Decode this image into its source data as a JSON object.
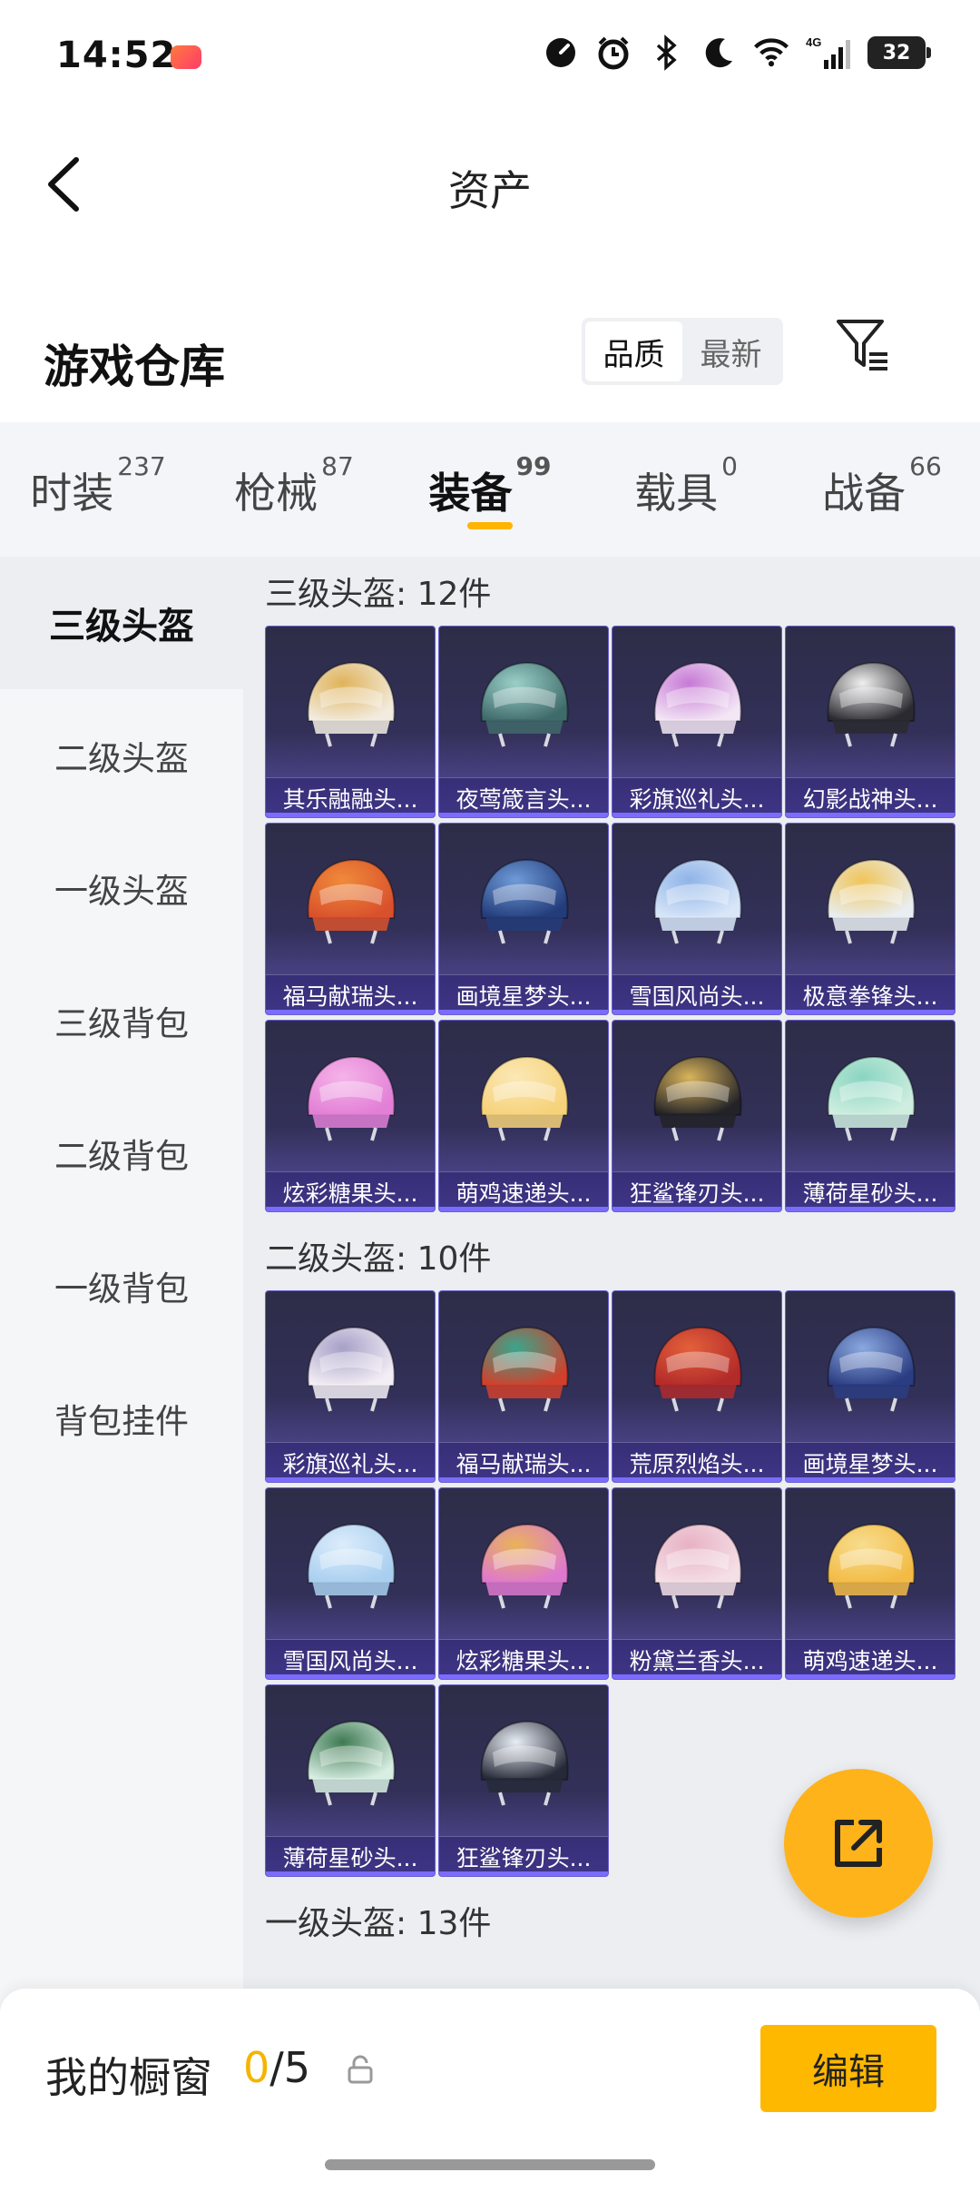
{
  "status_bar": {
    "time": "14:52",
    "battery": "32",
    "network": "4G"
  },
  "header": {
    "title": "资产"
  },
  "warehouse": {
    "title": "游戏仓库",
    "sort_options": [
      "品质",
      "最新"
    ],
    "sort_active": 0
  },
  "tabs": [
    {
      "label": "时装",
      "count": "237"
    },
    {
      "label": "枪械",
      "count": "87"
    },
    {
      "label": "装备",
      "count": "99",
      "active": true
    },
    {
      "label": "载具",
      "count": "0"
    },
    {
      "label": "战备",
      "count": "66"
    }
  ],
  "sidebar": {
    "items": [
      {
        "label": "三级头盔",
        "active": true
      },
      {
        "label": "二级头盔"
      },
      {
        "label": "一级头盔"
      },
      {
        "label": "三级背包"
      },
      {
        "label": "二级背包"
      },
      {
        "label": "一级背包"
      },
      {
        "label": "背包挂件"
      }
    ]
  },
  "sections": [
    {
      "title": "三级头盔: 12件",
      "items": [
        {
          "name": "其乐融融头...",
          "c1": "#f2ece0",
          "c2": "#e0b35a"
        },
        {
          "name": "夜莺箴言头...",
          "c1": "#3f6a6a",
          "c2": "#9ad0c8"
        },
        {
          "name": "彩旗巡礼头...",
          "c1": "#f3e6f5",
          "c2": "#c77ad6"
        },
        {
          "name": "幻影战神头...",
          "c1": "#2a2a30",
          "c2": "#f0f0f0"
        },
        {
          "name": "福马献瑞头...",
          "c1": "#d9512c",
          "c2": "#f08a3a"
        },
        {
          "name": "画境星梦头...",
          "c1": "#233c7a",
          "c2": "#6f9ad8"
        },
        {
          "name": "雪国风尚头...",
          "c1": "#d8e6f8",
          "c2": "#8fb4e8"
        },
        {
          "name": "极意拳锋头...",
          "c1": "#e9eef2",
          "c2": "#f0c55a"
        },
        {
          "name": "炫彩糖果头...",
          "c1": "#e27fd6",
          "c2": "#f5b3e8"
        },
        {
          "name": "萌鸡速递头...",
          "c1": "#f6d27a",
          "c2": "#fbe8b5"
        },
        {
          "name": "狂鲨锋刃头...",
          "c1": "#222228",
          "c2": "#d9b45a"
        },
        {
          "name": "薄荷星砂头...",
          "c1": "#cfeee0",
          "c2": "#8ad5c0"
        }
      ]
    },
    {
      "title": "二级头盔: 10件",
      "items": [
        {
          "name": "彩旗巡礼头...",
          "c1": "#f3eef5",
          "c2": "#a7a0c8"
        },
        {
          "name": "福马献瑞头...",
          "c1": "#d0402c",
          "c2": "#3aa58c"
        },
        {
          "name": "荒原烈焰头...",
          "c1": "#b22a2a",
          "c2": "#e3603a"
        },
        {
          "name": "画境星梦头...",
          "c1": "#2b3d82",
          "c2": "#8aa8e0"
        },
        {
          "name": "雪国风尚头...",
          "c1": "#a9cff0",
          "c2": "#dcecfb"
        },
        {
          "name": "炫彩糖果头...",
          "c1": "#de78cf",
          "c2": "#e8b35a"
        },
        {
          "name": "粉黛兰香头...",
          "c1": "#f5dfe6",
          "c2": "#e7b2c4"
        },
        {
          "name": "萌鸡速递头...",
          "c1": "#f3bb45",
          "c2": "#f7dd8e"
        },
        {
          "name": "薄荷星砂头...",
          "c1": "#d8eee3",
          "c2": "#3e7a52"
        },
        {
          "name": "狂鲨锋刃头...",
          "c1": "#262a38",
          "c2": "#e8eef5"
        }
      ]
    },
    {
      "title": "一级头盔: 13件",
      "items": []
    }
  ],
  "showcase": {
    "label": "我的橱窗",
    "count_used": "0",
    "count_total": "/5",
    "edit_label": "编辑"
  },
  "colors": {
    "accent": "#ffb800",
    "card_bg": "#2f2d52",
    "card_border": "#6a5fd0"
  }
}
